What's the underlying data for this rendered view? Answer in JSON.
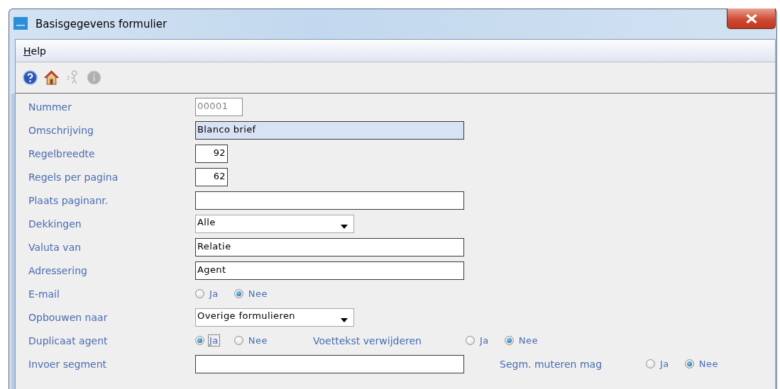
{
  "window": {
    "title": "Basisgegevens formulier"
  },
  "menu": [
    {
      "label": "Help"
    }
  ],
  "toolbar": [
    {
      "kind": "help",
      "disabled": false
    },
    {
      "kind": "home",
      "disabled": false
    },
    {
      "kind": "person",
      "disabled": true
    },
    {
      "kind": "info",
      "disabled": true
    }
  ],
  "form": [
    {
      "label": "Nummer",
      "kind": "code",
      "value": "00001",
      "disabled": true,
      "highlighted": false
    },
    {
      "label": "Omschrijving",
      "kind": "text",
      "value": "Blanco brief",
      "disabled": false,
      "highlighted": true
    },
    {
      "label": "Regelbreedte",
      "kind": "number",
      "value": "92",
      "disabled": false,
      "highlighted": false
    },
    {
      "label": "Regels per pagina",
      "kind": "number",
      "value": "62",
      "disabled": false,
      "highlighted": false
    },
    {
      "label": "Plaats paginanr.",
      "kind": "text",
      "disabled": false,
      "highlighted": false
    },
    {
      "label": "Dekkingen",
      "kind": "select",
      "value": "Alle"
    },
    {
      "label": "Valuta van",
      "kind": "text",
      "value": "Relatie",
      "disabled": false,
      "highlighted": false
    },
    {
      "label": "Adressering",
      "kind": "text",
      "value": "Agent",
      "disabled": false,
      "highlighted": false
    },
    {
      "label": "E-mail",
      "kind": "radio",
      "options": [
        {
          "label": "Ja",
          "selected": false,
          "focused": false
        },
        {
          "label": "Nee",
          "selected": true,
          "focused": false
        }
      ]
    },
    {
      "label": "Opbouwen naar",
      "kind": "select",
      "value": "Overige formulieren"
    },
    {
      "label": "Duplicaat agent",
      "kind": "radio",
      "options": [
        {
          "label": "Ja",
          "selected": true,
          "focused": true
        },
        {
          "label": "Nee",
          "selected": false,
          "focused": false
        }
      ],
      "extra": {
        "label": "Voettekst verwijderen",
        "options": [
          {
            "label": "Ja",
            "selected": false,
            "focused": false
          },
          {
            "label": "Nee",
            "selected": true,
            "focused": false
          }
        ]
      }
    },
    {
      "label": "Invoer segment",
      "kind": "text",
      "disabled": false,
      "highlighted": false,
      "extra": {
        "label": "Segm. muteren mag",
        "options": [
          {
            "label": "Ja",
            "selected": false,
            "focused": false
          },
          {
            "label": "Nee",
            "selected": true,
            "focused": false
          }
        ]
      }
    }
  ]
}
